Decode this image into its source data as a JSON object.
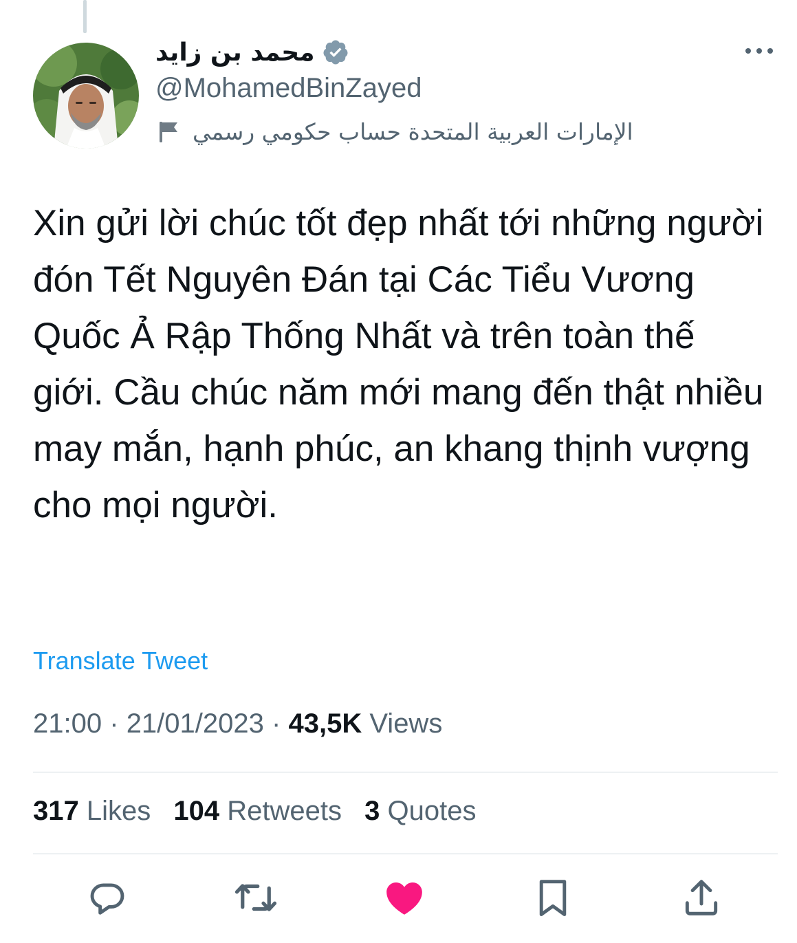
{
  "author": {
    "display_name": "محمد بن زايد",
    "handle": "@MohamedBinZayed",
    "verified_icon": "verified-badge-icon",
    "gov_label": "الإمارات العربية المتحدة حساب حكومي رسمي",
    "gov_label_icon": "flag-icon"
  },
  "tweet": {
    "text": "Xin gửi lời chúc tốt đẹp nhất tới những người đón Tết Nguyên Đán tại Các Tiểu Vương Quốc Ả Rập Thống Nhất và trên toàn thế giới. Cầu chúc năm mới mang đến thật nhiều may mắn, hạnh phúc, an khang thịnh vượng cho mọi người.",
    "translate_label": "Translate Tweet"
  },
  "meta": {
    "time": "21:00",
    "separator": "·",
    "date": "21/01/2023",
    "views_count": "43,5K",
    "views_label": "Views"
  },
  "stats": {
    "likes_count": "317",
    "likes_label": "Likes",
    "retweets_count": "104",
    "retweets_label": "Retweets",
    "quotes_count": "3",
    "quotes_label": "Quotes"
  },
  "actions": [
    "reply-icon",
    "retweet-icon",
    "like-icon",
    "bookmark-icon",
    "share-icon"
  ],
  "colors": {
    "text_primary": "#0f1419",
    "text_secondary": "#536471",
    "link": "#1d9bf0",
    "verified": "#829aab",
    "like_active": "#f91880",
    "divider": "#cfd9de"
  }
}
